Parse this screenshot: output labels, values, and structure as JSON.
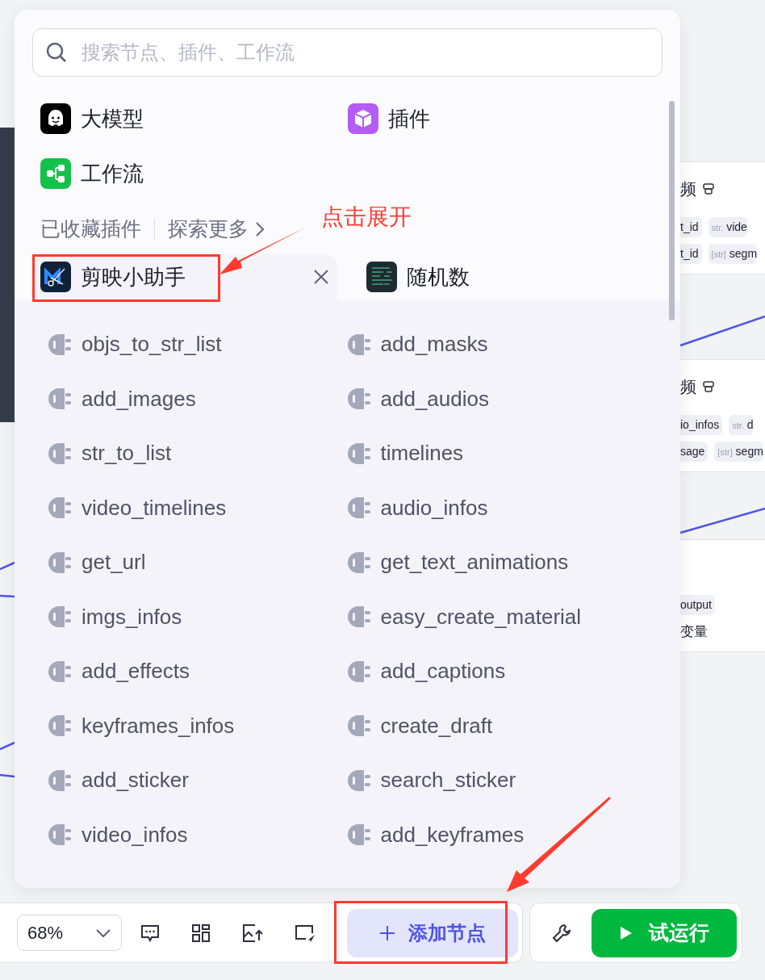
{
  "search": {
    "placeholder": "搜索节点、插件、工作流"
  },
  "categories": [
    {
      "label": "大模型",
      "kind": "model"
    },
    {
      "label": "插件",
      "kind": "plugin"
    },
    {
      "label": "工作流",
      "kind": "workflow"
    }
  ],
  "favorites": {
    "title": "已收藏插件",
    "explore_link": "探索更多"
  },
  "plugin_tabs": [
    {
      "label": "剪映小助手",
      "selected": true,
      "kind": "editor"
    },
    {
      "label": "随机数",
      "selected": false,
      "kind": "random"
    }
  ],
  "tools": [
    "objs_to_str_list",
    "add_masks",
    "add_images",
    "add_audios",
    "str_to_list",
    "timelines",
    "video_timelines",
    "audio_infos",
    "get_url",
    "get_text_animations",
    "imgs_infos",
    "easy_create_material",
    "add_effects",
    "add_captions",
    "keyframes_infos",
    "create_draft",
    "add_sticker",
    "search_sticker",
    "video_infos",
    "add_keyframes"
  ],
  "annotation": {
    "text": "点击展开"
  },
  "toolbar": {
    "zoom": "68%",
    "add_node": "添加节点",
    "run": "试运行"
  },
  "canvas_nodes": [
    {
      "title": "频",
      "rows": [
        [
          {
            "kind": "tag",
            "text": "t_id"
          },
          {
            "kind": "typed",
            "type": "str.",
            "text": "vide"
          }
        ],
        [
          {
            "kind": "tag",
            "text": "t_id"
          },
          {
            "kind": "typed",
            "type": "[str]",
            "text": "segm"
          }
        ]
      ]
    },
    {
      "title": "频",
      "rows": [
        [
          {
            "kind": "tag",
            "text": "io_infos"
          },
          {
            "kind": "typed",
            "type": "str.",
            "text": "d"
          }
        ],
        [
          {
            "kind": "tag",
            "text": "sage"
          },
          {
            "kind": "typed",
            "type": "[str]",
            "text": "segm"
          }
        ]
      ]
    },
    {
      "rows": [
        [
          {
            "kind": "tag",
            "text": "output"
          }
        ],
        [
          {
            "kind": "text",
            "text": "变量"
          }
        ]
      ]
    }
  ]
}
